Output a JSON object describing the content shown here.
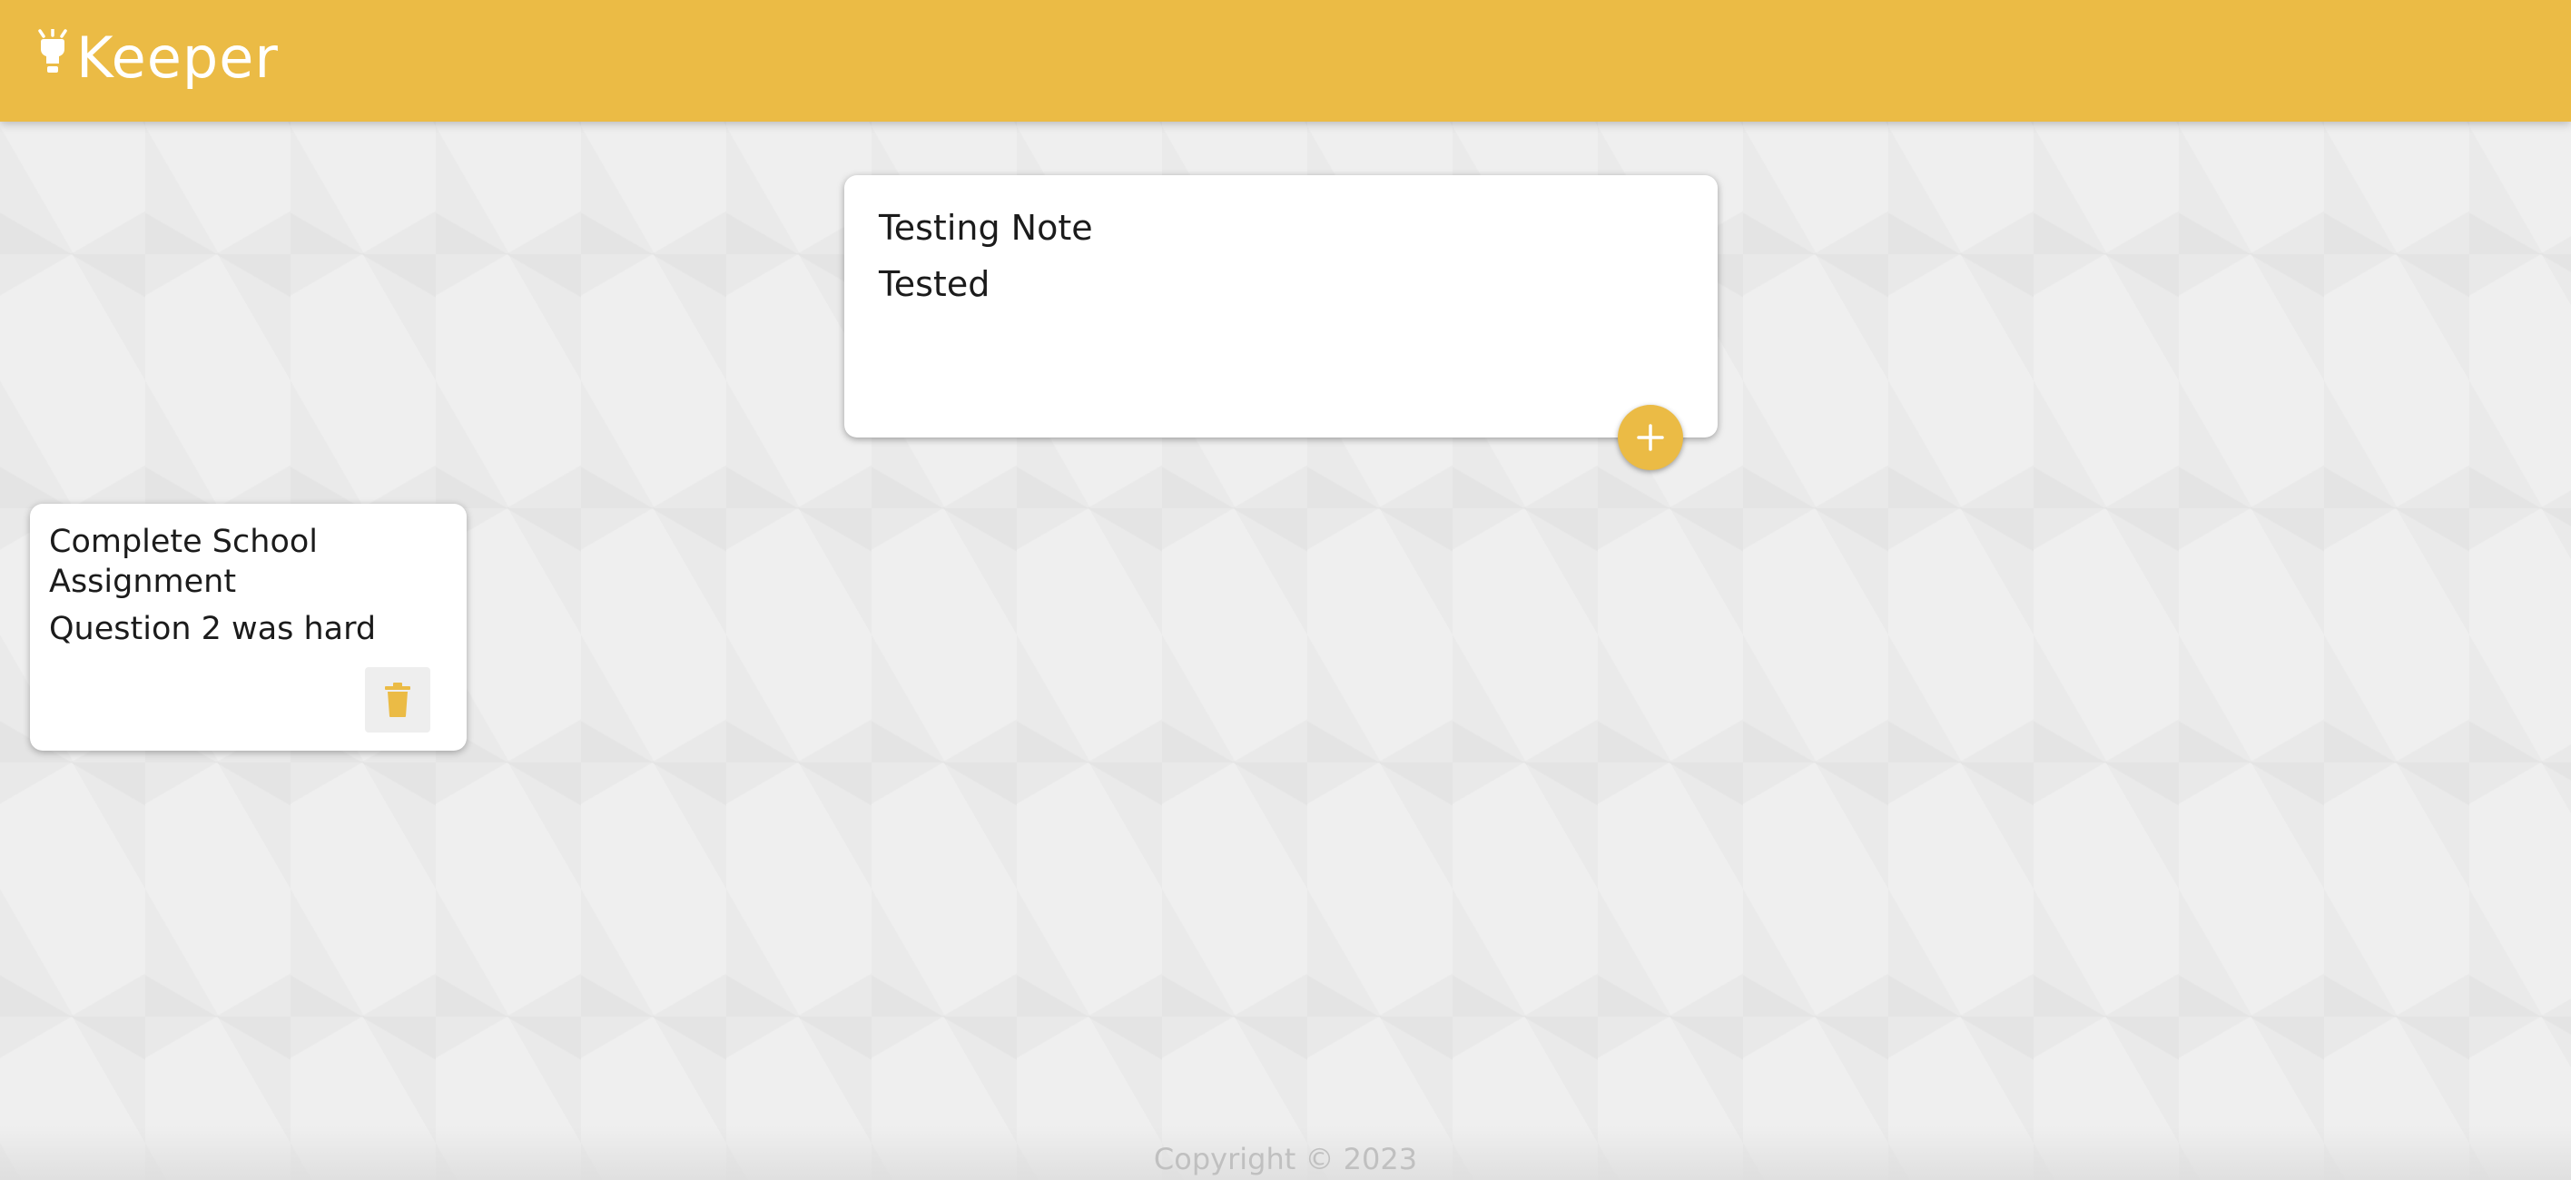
{
  "header": {
    "app_title": "Keeper",
    "logo_icon": "lightbulb-icon",
    "background_color": "#ebbb45"
  },
  "create_note": {
    "title_value": "Testing Note",
    "content_value": "Tested",
    "add_icon": "plus-icon"
  },
  "notes": [
    {
      "title": "Complete School Assignment",
      "content": "Question 2 was hard",
      "delete_icon": "trash-icon"
    }
  ],
  "footer": {
    "copyright": "Copyright © 2023"
  },
  "colors": {
    "accent": "#ebbb45",
    "background": "#efefef",
    "card": "#ffffff",
    "footer_text": "#c0c0c0"
  }
}
